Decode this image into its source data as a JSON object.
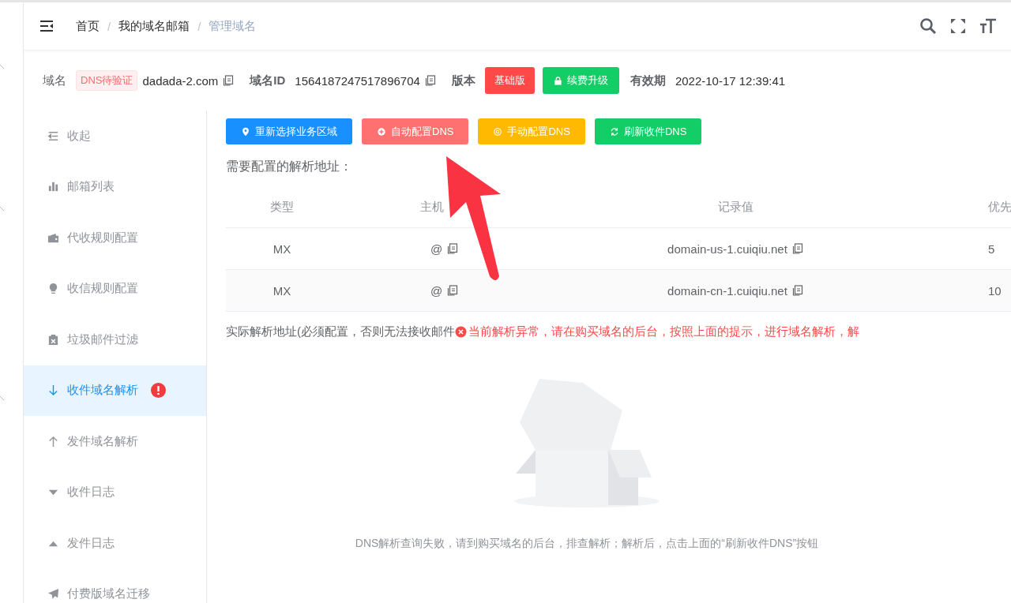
{
  "header": {
    "breadcrumb": [
      {
        "label": "首页",
        "current": false
      },
      {
        "label": "我的域名邮箱",
        "current": false
      },
      {
        "label": "管理域名",
        "current": true
      }
    ],
    "separator": "/"
  },
  "domain_info": {
    "domain_label": "域名",
    "status_tag": "DNS待验证",
    "domain": "dadada-2.com",
    "id_label": "域名ID",
    "id": "1564187247517896704",
    "version_label": "版本",
    "version": "基础版",
    "upgrade_button": "续费升级",
    "expiry_label": "有效期",
    "expiry": "2022-10-17 12:39:41"
  },
  "sidebar": {
    "items": [
      {
        "label": "收起",
        "selected": false,
        "alert": false
      },
      {
        "label": "邮箱列表",
        "selected": false,
        "alert": false
      },
      {
        "label": "代收规则配置",
        "selected": false,
        "alert": false
      },
      {
        "label": "收信规则配置",
        "selected": false,
        "alert": false
      },
      {
        "label": "垃圾邮件过滤",
        "selected": false,
        "alert": false
      },
      {
        "label": "收件域名解析",
        "selected": true,
        "alert": true
      },
      {
        "label": "发件域名解析",
        "selected": false,
        "alert": false
      },
      {
        "label": "收件日志",
        "selected": false,
        "alert": false
      },
      {
        "label": "发件日志",
        "selected": false,
        "alert": false
      },
      {
        "label": "付费版域名迁移",
        "selected": false,
        "alert": false
      }
    ]
  },
  "actions": [
    {
      "label": "重新选择业务区域",
      "kind": "region"
    },
    {
      "label": "自动配置DNS",
      "kind": "auto"
    },
    {
      "label": "手动配置DNS",
      "kind": "manual"
    },
    {
      "label": "刷新收件DNS",
      "kind": "refresh"
    }
  ],
  "records": {
    "title": "需要配置的解析地址：",
    "columns": [
      "类型",
      "主机",
      "记录值",
      "优先"
    ],
    "rows": [
      {
        "type": "MX",
        "host": "@",
        "value": "domain-us-1.cuiqiu.net",
        "priority": "5"
      },
      {
        "type": "MX",
        "host": "@",
        "value": "domain-cn-1.cuiqiu.net",
        "priority": "10"
      }
    ]
  },
  "actual": {
    "label": "实际解析地址(必须配置，否则无法接收邮件",
    "error": "当前解析异常，请在购买域名的后台，按照上面的提示，进行域名解析，解"
  },
  "empty_state": {
    "message": "DNS解析查询失败，请到购买域名的后台，排查解析；解析后，点击上面的“刷新收件DNS”按钮"
  }
}
